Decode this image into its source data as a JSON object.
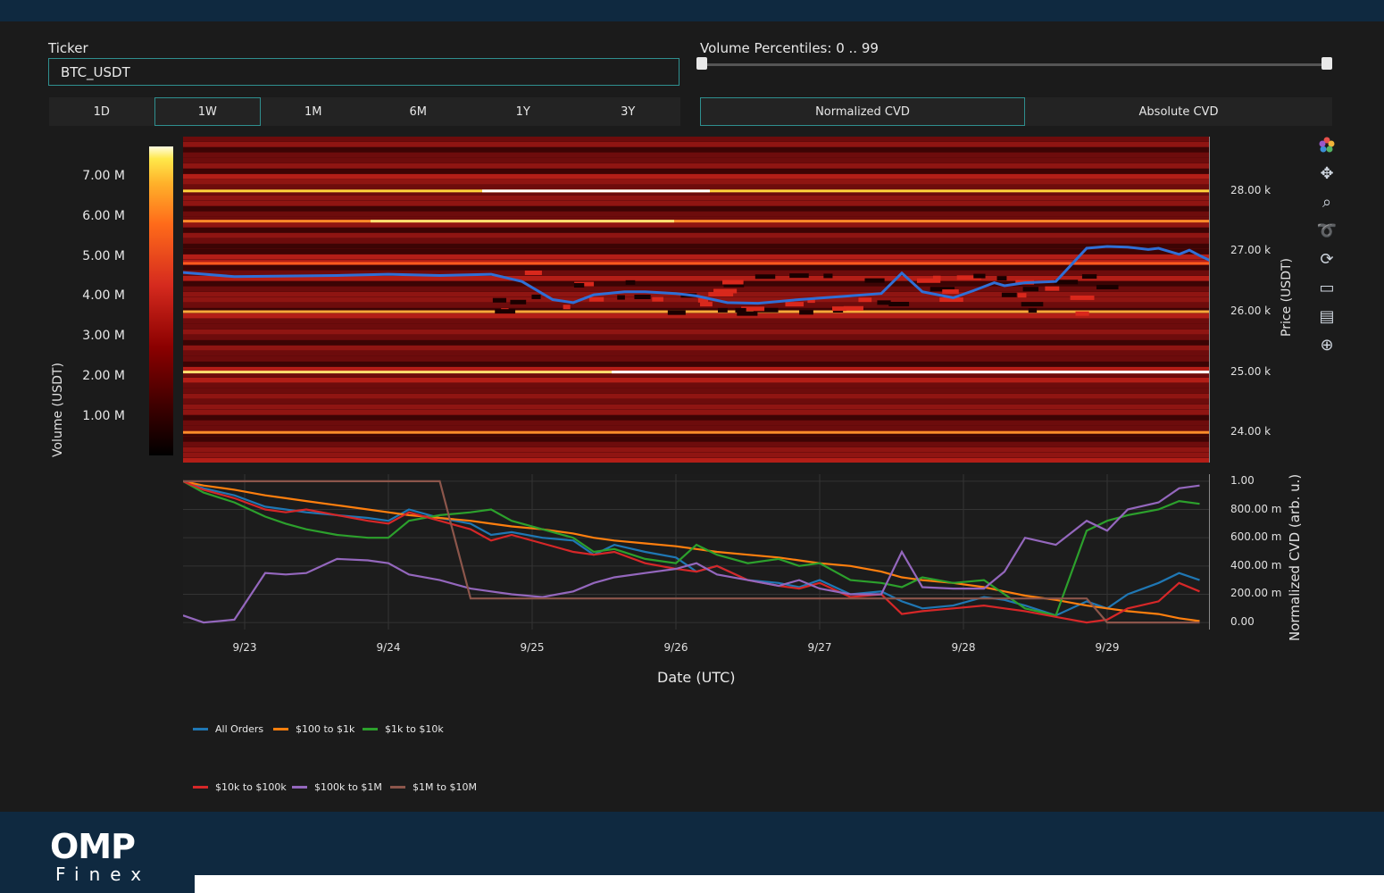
{
  "ticker": {
    "label": "Ticker",
    "value": "BTC_USDT"
  },
  "volume_percentiles": {
    "label": "Volume Percentiles: 0 .. 99",
    "min": 0,
    "max": 99
  },
  "range_buttons": [
    {
      "label": "1D",
      "active": false
    },
    {
      "label": "1W",
      "active": true
    },
    {
      "label": "1M",
      "active": false
    },
    {
      "label": "6M",
      "active": false
    },
    {
      "label": "1Y",
      "active": false
    },
    {
      "label": "3Y",
      "active": false
    }
  ],
  "cvd_mode_buttons": [
    {
      "label": "Normalized CVD",
      "active": true
    },
    {
      "label": "Absolute CVD",
      "active": false
    }
  ],
  "toolbar_icons": [
    "plotly-logo-icon",
    "pan-icon",
    "zoom-icon",
    "lasso-icon",
    "reset-icon",
    "save-icon",
    "comment-icon",
    "crosshair-icon"
  ],
  "legend": [
    {
      "name": "All Orders",
      "color": "#1f77b4"
    },
    {
      "name": "$100 to $1k",
      "color": "#ff7f0e"
    },
    {
      "name": "$1k to $10k",
      "color": "#2ca02c"
    },
    {
      "name": "$10k to $100k",
      "color": "#d62728"
    },
    {
      "name": "$100k to $1M",
      "color": "#9467bd"
    },
    {
      "name": "$1M to $10M",
      "color": "#8c564b"
    }
  ],
  "logo": {
    "big": "OMP",
    "small": "Finex"
  },
  "chart_data": [
    {
      "type": "heatmap",
      "title": "",
      "xlabel": "",
      "ylabel": "Price (USDT)",
      "colorbar_label": "Volume (USDT)",
      "colorbar_ticks": [
        "7.00 M",
        "6.00 M",
        "5.00 M",
        "4.00 M",
        "3.00 M",
        "2.00 M",
        "1.00 M"
      ],
      "y_ticks": [
        "28.00 k",
        "27.00 k",
        "26.00 k",
        "25.00 k",
        "24.00 k"
      ],
      "ylim": [
        23500,
        28900
      ],
      "colorscale": [
        "#000000",
        "#8b0000",
        "#d52a1e",
        "#ff6b1a",
        "#ffe84a",
        "#ffffff"
      ],
      "price_line": {
        "color": "#2f6fd6",
        "x": [
          0,
          0.05,
          0.1,
          0.15,
          0.2,
          0.25,
          0.3,
          0.33,
          0.36,
          0.38,
          0.4,
          0.43,
          0.45,
          0.48,
          0.5,
          0.53,
          0.56,
          0.6,
          0.64,
          0.68,
          0.7,
          0.72,
          0.75,
          0.77,
          0.79,
          0.8,
          0.82,
          0.85,
          0.88,
          0.9,
          0.92,
          0.94,
          0.95,
          0.96,
          0.97,
          0.98,
          0.99,
          1.0
        ],
        "y": [
          26650,
          26580,
          26590,
          26600,
          26620,
          26600,
          26620,
          26500,
          26200,
          26150,
          26280,
          26330,
          26330,
          26300,
          26260,
          26150,
          26140,
          26200,
          26250,
          26300,
          26640,
          26330,
          26230,
          26350,
          26480,
          26430,
          26480,
          26500,
          27050,
          27080,
          27070,
          27030,
          27050,
          27000,
          26950,
          27020,
          26930,
          26850
        ]
      }
    },
    {
      "type": "line",
      "title": "",
      "xlabel": "Date (UTC)",
      "ylabel": "Normalized CVD (arb. u.)",
      "x_ticks": [
        "9/23",
        "9/24",
        "9/25",
        "9/26",
        "9/27",
        "9/28",
        "9/29"
      ],
      "y_ticks": [
        "1.00",
        "800.00 m",
        "600.00 m",
        "400.00 m",
        "200.00 m",
        "0.00"
      ],
      "ylim": [
        -0.05,
        1.05
      ],
      "x": [
        0,
        0.02,
        0.05,
        0.08,
        0.1,
        0.12,
        0.15,
        0.18,
        0.2,
        0.22,
        0.25,
        0.28,
        0.3,
        0.32,
        0.35,
        0.38,
        0.4,
        0.42,
        0.45,
        0.48,
        0.5,
        0.52,
        0.55,
        0.58,
        0.6,
        0.62,
        0.65,
        0.68,
        0.7,
        0.72,
        0.75,
        0.78,
        0.8,
        0.82,
        0.85,
        0.88,
        0.9,
        0.92,
        0.95,
        0.97,
        0.99
      ],
      "series": [
        {
          "name": "All Orders",
          "values": [
            1.0,
            0.95,
            0.9,
            0.82,
            0.8,
            0.78,
            0.76,
            0.74,
            0.72,
            0.8,
            0.74,
            0.7,
            0.62,
            0.64,
            0.6,
            0.58,
            0.48,
            0.55,
            0.5,
            0.46,
            0.36,
            0.4,
            0.3,
            0.28,
            0.25,
            0.3,
            0.2,
            0.22,
            0.15,
            0.1,
            0.12,
            0.18,
            0.16,
            0.12,
            0.05,
            0.15,
            0.1,
            0.2,
            0.28,
            0.35,
            0.3
          ]
        },
        {
          "name": "$100 to $1k",
          "values": [
            1.0,
            0.97,
            0.94,
            0.9,
            0.88,
            0.86,
            0.83,
            0.8,
            0.78,
            0.76,
            0.74,
            0.72,
            0.7,
            0.68,
            0.66,
            0.63,
            0.6,
            0.58,
            0.56,
            0.54,
            0.52,
            0.5,
            0.48,
            0.46,
            0.44,
            0.42,
            0.4,
            0.36,
            0.32,
            0.3,
            0.28,
            0.25,
            0.22,
            0.19,
            0.16,
            0.12,
            0.1,
            0.08,
            0.06,
            0.03,
            0.01
          ]
        },
        {
          "name": "$1k to $10k",
          "values": [
            1.0,
            0.92,
            0.85,
            0.75,
            0.7,
            0.66,
            0.62,
            0.6,
            0.6,
            0.72,
            0.76,
            0.78,
            0.8,
            0.72,
            0.66,
            0.6,
            0.5,
            0.52,
            0.45,
            0.42,
            0.55,
            0.48,
            0.42,
            0.45,
            0.4,
            0.42,
            0.3,
            0.28,
            0.25,
            0.32,
            0.28,
            0.3,
            0.2,
            0.1,
            0.05,
            0.65,
            0.72,
            0.76,
            0.8,
            0.86,
            0.84
          ]
        },
        {
          "name": "$10k to $100k",
          "values": [
            1.0,
            0.94,
            0.88,
            0.8,
            0.78,
            0.8,
            0.76,
            0.72,
            0.7,
            0.78,
            0.72,
            0.66,
            0.58,
            0.62,
            0.56,
            0.5,
            0.48,
            0.5,
            0.42,
            0.38,
            0.36,
            0.4,
            0.3,
            0.26,
            0.24,
            0.28,
            0.18,
            0.2,
            0.06,
            0.08,
            0.1,
            0.12,
            0.1,
            0.08,
            0.04,
            0.0,
            0.02,
            0.1,
            0.15,
            0.28,
            0.22
          ]
        },
        {
          "name": "$100k to $1M",
          "values": [
            0.05,
            0.0,
            0.02,
            0.35,
            0.34,
            0.35,
            0.45,
            0.44,
            0.42,
            0.34,
            0.3,
            0.24,
            0.22,
            0.2,
            0.18,
            0.22,
            0.28,
            0.32,
            0.35,
            0.38,
            0.42,
            0.34,
            0.3,
            0.26,
            0.3,
            0.24,
            0.2,
            0.2,
            0.5,
            0.25,
            0.24,
            0.24,
            0.36,
            0.6,
            0.55,
            0.72,
            0.65,
            0.8,
            0.85,
            0.95,
            0.97
          ]
        },
        {
          "name": "$1M to $10M",
          "values": [
            1.0,
            1.0,
            1.0,
            1.0,
            1.0,
            1.0,
            1.0,
            1.0,
            1.0,
            1.0,
            1.0,
            0.17,
            0.17,
            0.17,
            0.17,
            0.17,
            0.17,
            0.17,
            0.17,
            0.17,
            0.17,
            0.17,
            0.17,
            0.17,
            0.17,
            0.17,
            0.17,
            0.17,
            0.17,
            0.17,
            0.17,
            0.17,
            0.17,
            0.17,
            0.17,
            0.17,
            0.0,
            0.0,
            0.0,
            0.0,
            0.0
          ]
        }
      ]
    }
  ]
}
